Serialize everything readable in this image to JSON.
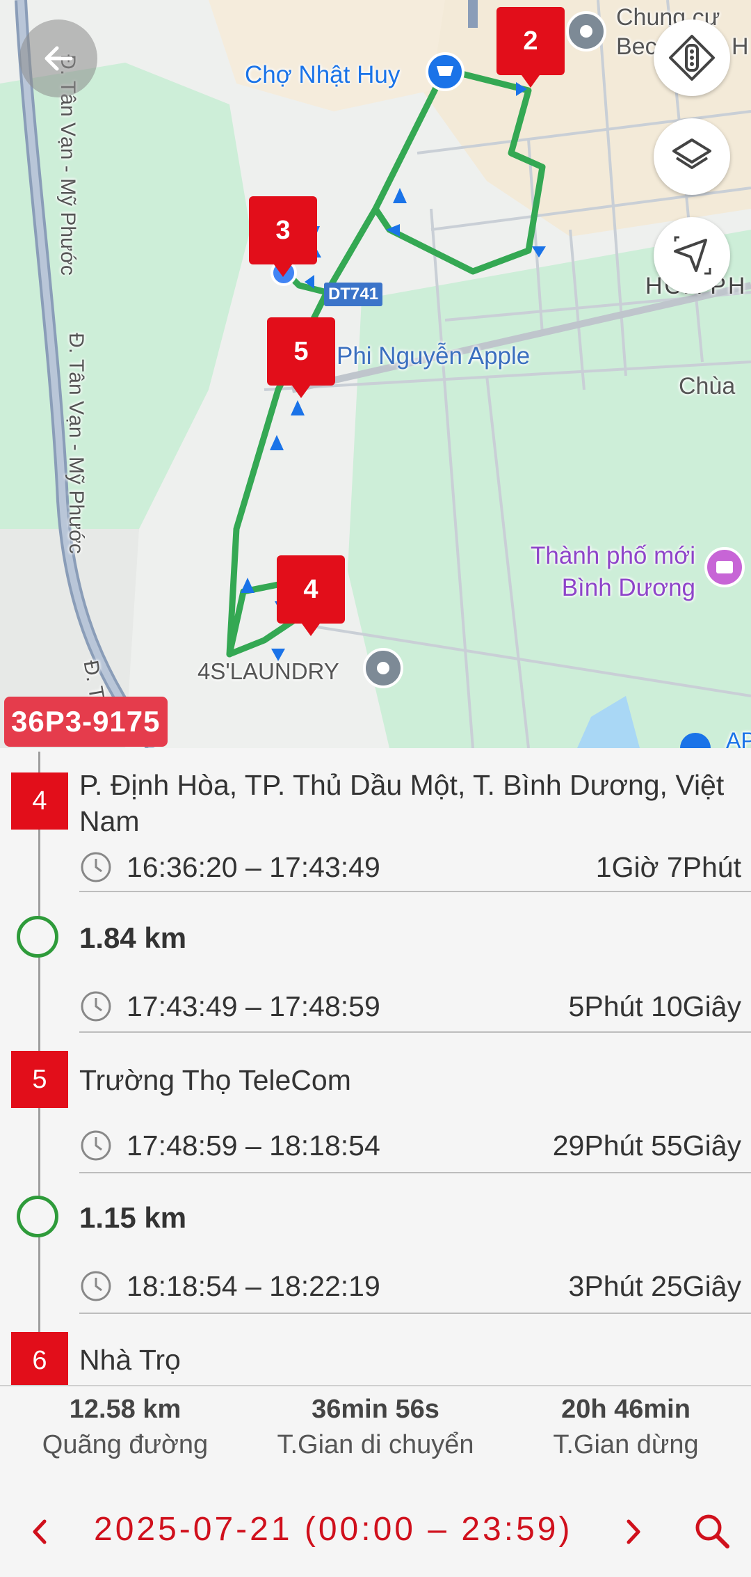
{
  "map": {
    "labels": {
      "market": "Chợ Nhật Huy",
      "apartment_line1": "Chung cư",
      "apartment_line2": "Bec",
      "apartment_frag": "H",
      "road_west_1": "Đ. Tân Vạn - Mỹ Phước",
      "road_west_2": "Đ. Tân Vạn - Mỹ Phước",
      "road_west_3": "Đ. T",
      "road_badge": "DT741",
      "phi_nguyen": "Phi Nguyễn Apple",
      "hoa_phu": "HÒA PH",
      "chua": "Chùa",
      "new_city_line1": "Thành phố mới",
      "new_city_line2": "Bình Dương",
      "laundry": "4S'LAUNDRY",
      "ap": "AP"
    },
    "markers": [
      "2",
      "3",
      "5",
      "4"
    ],
    "vehicle_plate": "36P3-9175",
    "route_color": "#34a853",
    "marker_color": "#e20e1a"
  },
  "buttons": {
    "back": "back-arrow-icon",
    "traffic": "traffic-light-icon",
    "layers": "layers-icon",
    "locate": "navigation-arrow-icon"
  },
  "timeline": {
    "stops": [
      {
        "index": "4",
        "address": "P. Định Hòa, TP. Thủ Dầu Một, T. Bình Dương, Việt Nam",
        "time_range": "16:36:20 – 17:43:49",
        "duration": "1Giờ 7Phút"
      },
      {
        "index": "5",
        "address": "Trường Thọ TeleCom",
        "time_range": "17:48:59 – 18:18:54",
        "duration": "29Phút 55Giây"
      },
      {
        "index": "6",
        "address": "Nhà Trọ"
      }
    ],
    "moves": [
      {
        "distance": "1.84 km",
        "time_range": "17:43:49 – 17:48:59",
        "duration": "5Phút 10Giây"
      },
      {
        "distance": "1.15 km",
        "time_range": "18:18:54 – 18:22:19",
        "duration": "3Phút 25Giây"
      }
    ]
  },
  "summary": {
    "distance_value": "12.58 km",
    "distance_label": "Quãng đường",
    "moving_value": "36min 56s",
    "moving_label": "T.Gian di chuyển",
    "stop_value": "20h 46min",
    "stop_label": "T.Gian dừng"
  },
  "datebar": {
    "date_text": "2025-07-21 (00:00 – 23:59)",
    "accent": "#d0101c"
  }
}
